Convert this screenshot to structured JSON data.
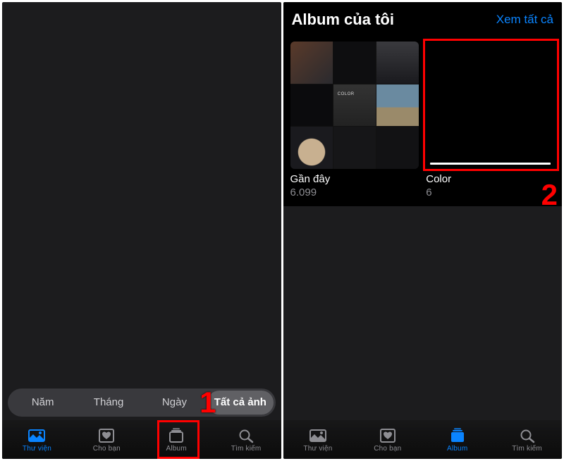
{
  "annotations": {
    "step1": "1",
    "step2": "2"
  },
  "phone1": {
    "segments": {
      "year": "Năm",
      "month": "Tháng",
      "day": "Ngày",
      "all": "Tất cả ảnh"
    },
    "tabs": {
      "library": "Thư viện",
      "for_you": "Cho bạn",
      "album": "Album",
      "search": "Tìm kiếm"
    }
  },
  "phone2": {
    "header": {
      "title": "Album của tôi",
      "see_all": "Xem tất cả"
    },
    "albums": [
      {
        "name": "Gần đây",
        "count": "6.099"
      },
      {
        "name": "Color",
        "count": "6"
      }
    ],
    "tabs": {
      "library": "Thư viện",
      "for_you": "Cho bạn",
      "album": "Album",
      "search": "Tìm kiếm"
    }
  }
}
